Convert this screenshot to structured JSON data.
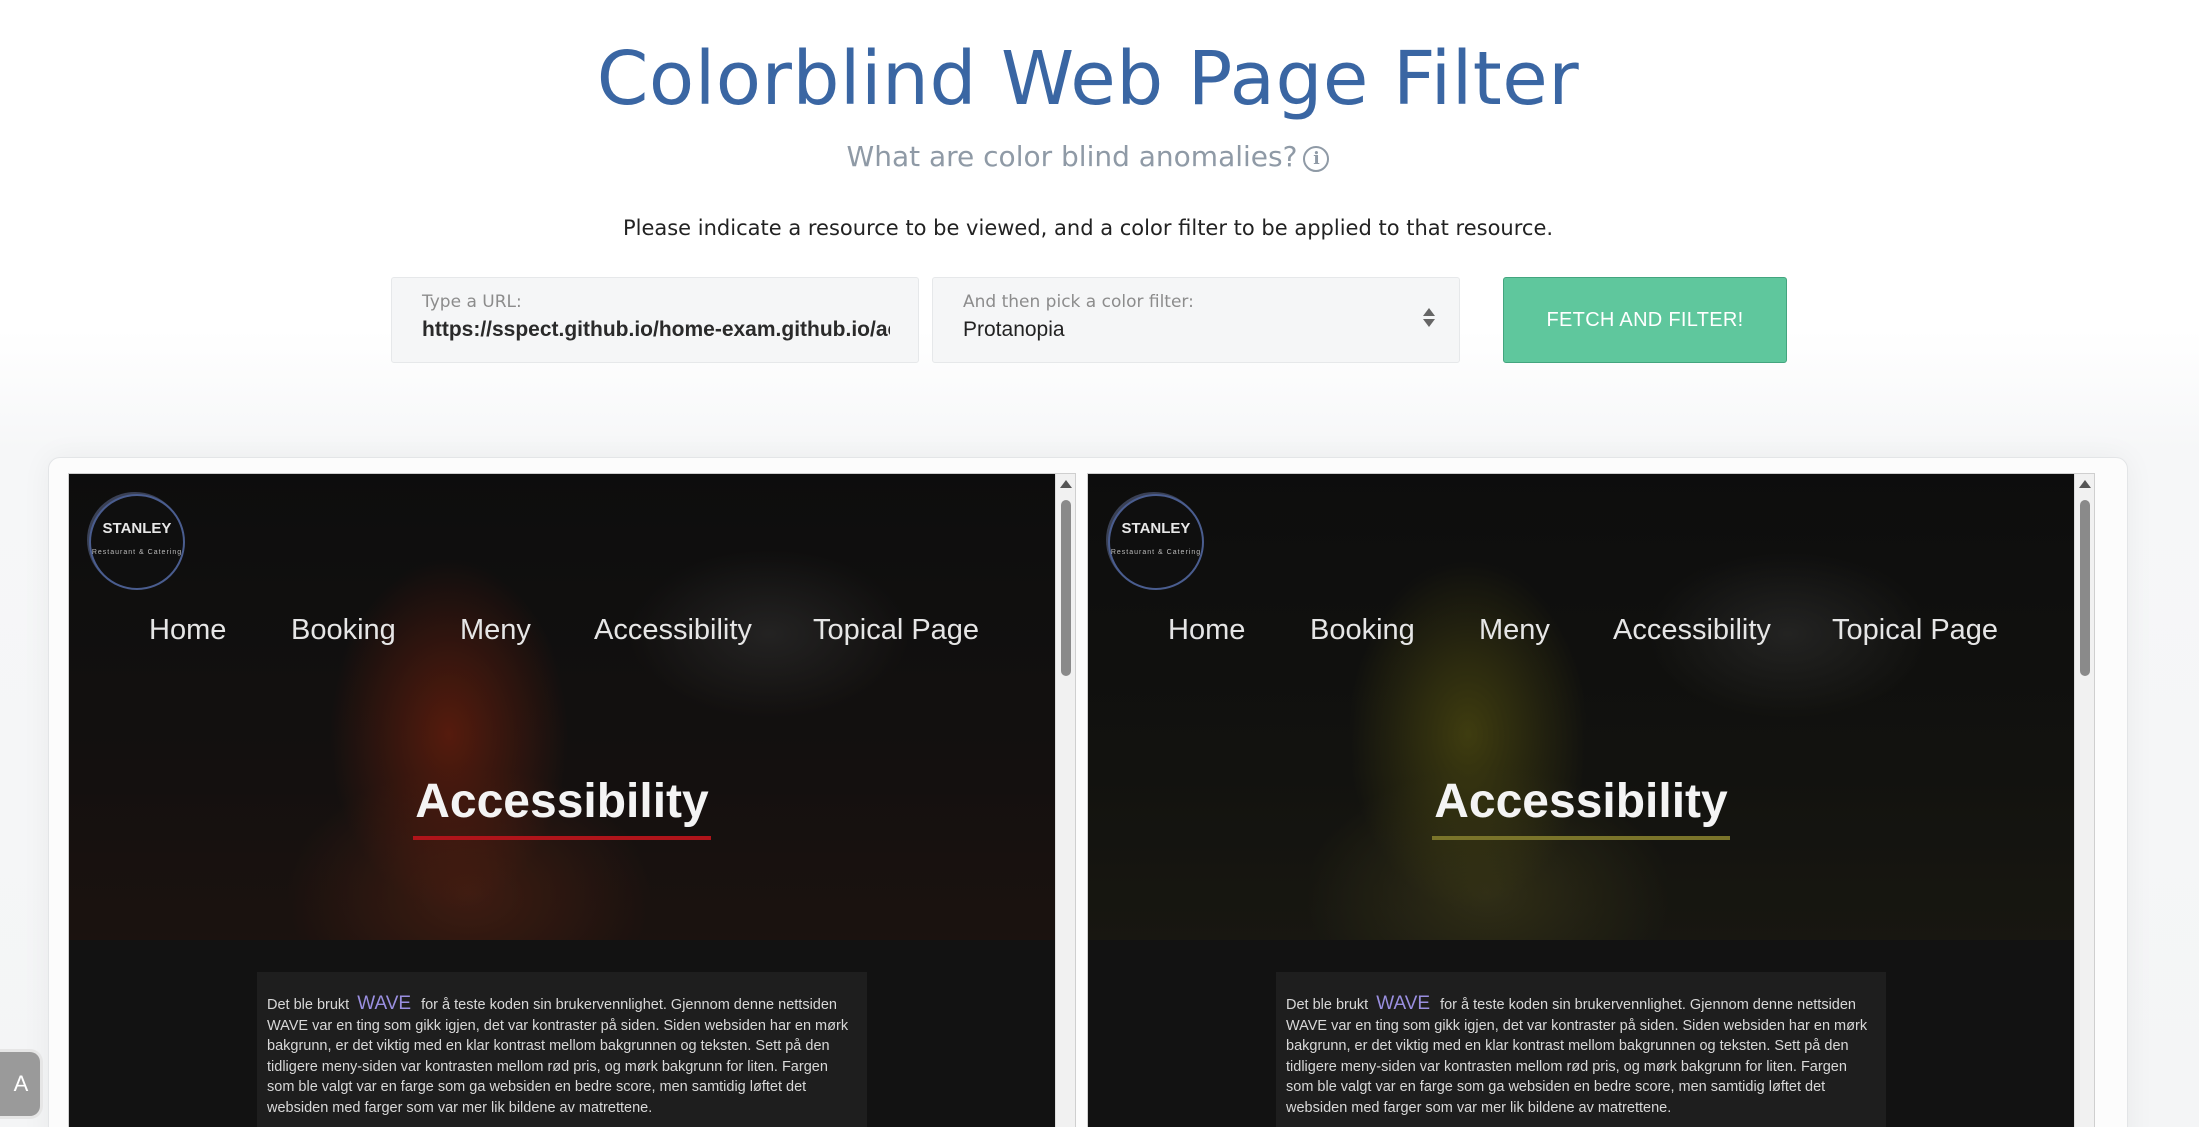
{
  "header": {
    "title": "Colorblind Web Page Filter",
    "subtitle": "What are color blind anomalies?",
    "info_icon": "i",
    "instruction": "Please indicate a resource to be viewed, and a color filter to be applied to that resource."
  },
  "form": {
    "url_label": "Type a URL:",
    "url_value": "https://sspect.github.io/home-exam.github.io/accessibility.html",
    "filter_label": "And then pick a color filter:",
    "filter_value": "Protanopia",
    "submit_label": "FETCH AND FILTER!"
  },
  "preview": {
    "logo_brand": "STANLEY",
    "logo_tagline": "Restaurant & Catering",
    "nav": [
      "Home",
      "Booking",
      "Meny",
      "Accessibility",
      "Topical Page"
    ],
    "heading": "Accessibility",
    "text_before": "Det ble brukt",
    "wave": "WAVE",
    "text_after": "for å teste koden sin brukervennlighet. Gjennom denne nettsiden WAVE var en ting som gikk igjen, det var kontraster på siden. Siden websiden har en mørk bakgrunn, er det viktig med en klar kontrast mellom bakgrunnen og teksten. Sett på den tidligere meny-siden var kontrasten mellom rød pris, og mørk bakgrunn for liten. Fargen som ble valgt var en farge som ga websiden en bedre score, men samtidig løftet det websiden med farger som var mer lik bildene av matrettene."
  },
  "accessibility_widget": {
    "label": "A"
  },
  "colors": {
    "title": "#3a66a3",
    "button": "#5fc79d",
    "original_accent": "#b0141a",
    "filtered_accent": "#7a742a"
  }
}
